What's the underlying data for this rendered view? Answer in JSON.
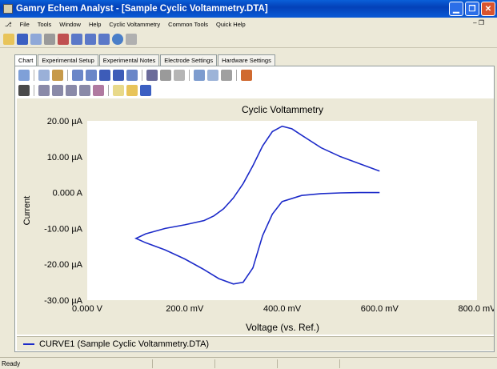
{
  "window": {
    "title": "Gamry Echem Analyst - [Sample Cyclic Voltammetry.DTA]"
  },
  "menu": [
    "File",
    "Tools",
    "Window",
    "Help",
    "Cyclic Voltammetry",
    "Common Tools",
    "Quick Help"
  ],
  "tabs": [
    "Chart",
    "Experimental Setup",
    "Experimental Notes",
    "Electrode Settings",
    "Hardware Settings"
  ],
  "status": {
    "text": "Ready"
  },
  "chart_data": {
    "type": "line",
    "title": "Cyclic Voltammetry",
    "xlabel": "Voltage (vs. Ref.)",
    "ylabel": "Current",
    "xlim": [
      0,
      800
    ],
    "ylim": [
      -30,
      20
    ],
    "x_ticks": [
      "0.000 V",
      "200.0 mV",
      "400.0 mV",
      "600.0 mV",
      "800.0 mV"
    ],
    "y_ticks": [
      "20.00 µA",
      "10.00 µA",
      "0.000 A",
      "-10.00 µA",
      "-20.00 µA",
      "-30.00 µA"
    ],
    "legend": [
      "CURVE1 (Sample Cyclic Voltammetry.DTA)"
    ],
    "series": [
      {
        "name": "CURVE1 (Sample Cyclic Voltammetry.DTA)",
        "x": [
          600,
          560,
          520,
          480,
          440,
          420,
          400,
          380,
          360,
          340,
          320,
          300,
          280,
          260,
          240,
          200,
          160,
          120,
          100,
          120,
          160,
          200,
          240,
          270,
          300,
          320,
          340,
          360,
          380,
          400,
          440,
          480,
          520,
          560,
          600
        ],
        "y": [
          6,
          8,
          10,
          12.5,
          16,
          17.8,
          18.5,
          17,
          13,
          7.5,
          2.5,
          -1.5,
          -4.5,
          -6.5,
          -7.8,
          -9,
          -10,
          -11.5,
          -12.8,
          -14,
          -16,
          -18.5,
          -21.5,
          -24,
          -25.5,
          -25,
          -21,
          -12,
          -6,
          -2.5,
          -0.8,
          -0.3,
          -0.1,
          0,
          0
        ]
      }
    ]
  }
}
